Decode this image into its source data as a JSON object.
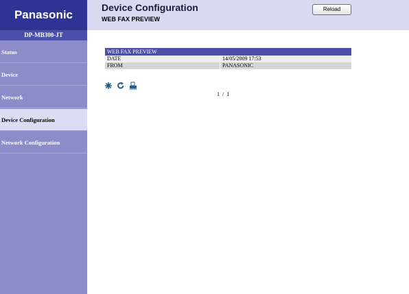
{
  "sidebar": {
    "logo": "Panasonic",
    "model": "DP-MB300-JT",
    "items": [
      {
        "label": "Status",
        "active": false
      },
      {
        "label": "Device",
        "active": false
      },
      {
        "label": "Network",
        "active": false
      },
      {
        "label": "Device Configuration",
        "active": true
      },
      {
        "label": "Network Configuration",
        "active": false
      }
    ]
  },
  "header": {
    "title": "Device Configuration",
    "subtitle": "WEB FAX PREVIEW",
    "reload_label": "Reload"
  },
  "preview": {
    "heading": "WEB FAX PREVIEW",
    "rows": [
      {
        "label": "DATE",
        "value": "14/05/2009 17:53"
      },
      {
        "label": "FROM",
        "value": "PANASONIC"
      }
    ]
  },
  "toolbar": {
    "icons": [
      "zoom-icon",
      "rotate-icon",
      "print-icon"
    ]
  },
  "pager": {
    "text": "1  /  1"
  },
  "colors": {
    "sidebar": "#8c8cc8",
    "logo_bg": "#2d3494",
    "accent": "#4c4fa8",
    "header_bg": "#d8daf2",
    "icon": "#1f5e8e"
  }
}
